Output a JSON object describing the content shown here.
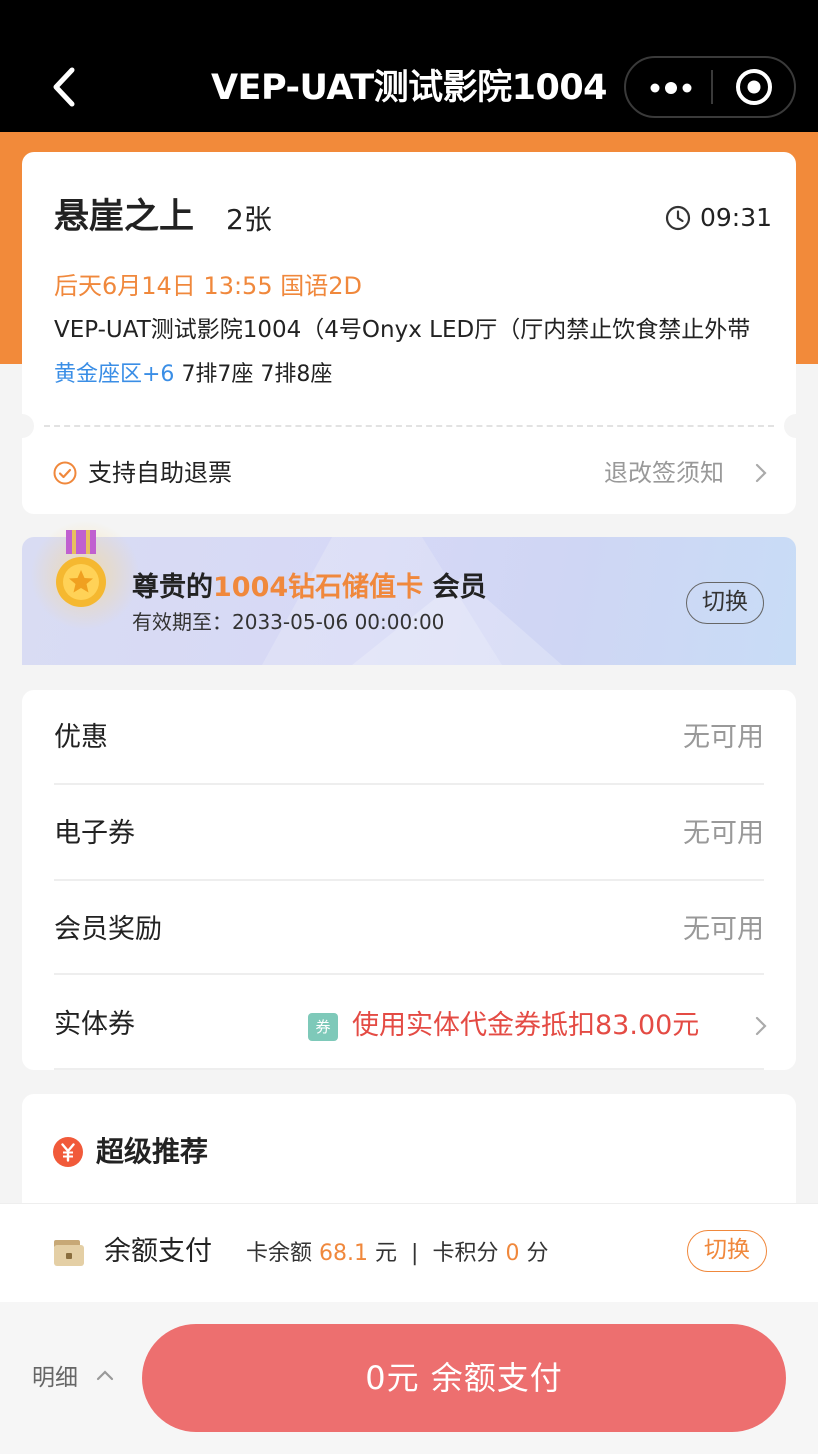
{
  "header": {
    "title": "VEP-UAT测试影院1004"
  },
  "movie": {
    "title": "悬崖之上",
    "ticket_count": "2张",
    "countdown": "09:31",
    "show_time": "后天6月14日 13:55 国语2D",
    "cinema": "VEP-UAT测试影院1004（4号Onyx LED厅（厅内禁止饮食禁止外带",
    "zone": "黄金座区+6",
    "seats": "7排7座 7排8座"
  },
  "refund": {
    "label": "支持自助退票",
    "rules": "退改签须知"
  },
  "member": {
    "prefix": "尊贵的",
    "card_name": "1004钻石储值卡",
    "suffix": "会员",
    "expire": "有效期至：2033-05-06 00:00:00",
    "switch": "切换"
  },
  "discounts": [
    {
      "label": "优惠",
      "value": "无可用"
    },
    {
      "label": "电子券",
      "value": "无可用"
    },
    {
      "label": "会员奖励",
      "value": "无可用"
    },
    {
      "label": "实体券",
      "coupon_badge": "券",
      "value": "使用实体代金券抵扣83.00元"
    }
  ],
  "recommend": {
    "title": "超级推荐"
  },
  "payment": {
    "method": "余额支付",
    "balance_label": "卡余额",
    "balance_value": "68.1",
    "balance_unit": "元",
    "separator": "|",
    "points_label": "卡积分",
    "points_value": "0",
    "points_unit": "分",
    "switch": "切换"
  },
  "footer": {
    "detail": "明细",
    "pay_button": "0元  余额支付"
  },
  "colors": {
    "brand_orange": "#f28a3a",
    "accent_orange": "#f0883c",
    "pay_red": "#ed6f6f",
    "link_blue": "#3a8ee6"
  }
}
